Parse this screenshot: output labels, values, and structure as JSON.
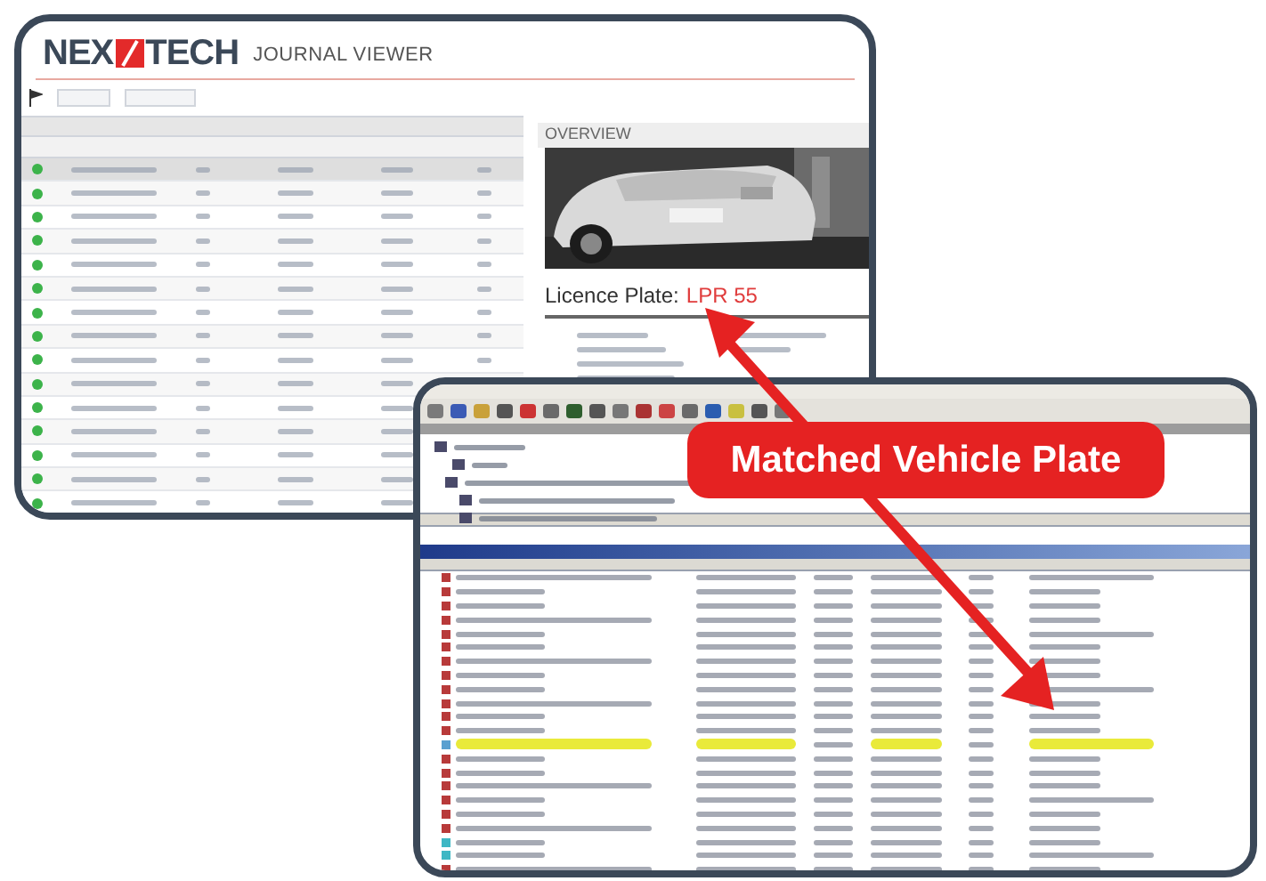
{
  "journal_viewer": {
    "logo": {
      "left": "NEX",
      "right": "TECH"
    },
    "title": "JOURNAL VIEWER",
    "rows": [
      {
        "color": "#3cb34a",
        "selected": true
      },
      {
        "color": "#3cb34a",
        "selected": false
      },
      {
        "color": "#3cb34a",
        "selected": false
      },
      {
        "color": "#3cb34a",
        "selected": false
      },
      {
        "color": "#3cb34a",
        "selected": false
      },
      {
        "color": "#3cb34a",
        "selected": false
      },
      {
        "color": "#3cb34a",
        "selected": false
      },
      {
        "color": "#3cb34a",
        "selected": false
      },
      {
        "color": "#3cb34a",
        "selected": false
      },
      {
        "color": "#3cb34a",
        "selected": false
      },
      {
        "color": "#3cb34a",
        "selected": false
      },
      {
        "color": "#3cb34a",
        "selected": false
      },
      {
        "color": "#3cb34a",
        "selected": false
      },
      {
        "color": "#3cb34a",
        "selected": false
      },
      {
        "color": "#3cb34a",
        "selected": false
      }
    ],
    "overview": {
      "heading": "OVERVIEW",
      "plate_label": "Licence Plate:",
      "plate_value": "LPR 55"
    }
  },
  "alarm_window": {
    "rows": [
      {
        "color": "#b83a3a",
        "highlighted": false
      },
      {
        "color": "#b83a3a",
        "highlighted": false
      },
      {
        "color": "#b83a3a",
        "highlighted": false
      },
      {
        "color": "#b83a3a",
        "highlighted": false
      },
      {
        "color": "#b83a3a",
        "highlighted": false
      },
      {
        "color": "#b83a3a",
        "highlighted": false
      },
      {
        "color": "#b83a3a",
        "highlighted": false
      },
      {
        "color": "#b83a3a",
        "highlighted": false
      },
      {
        "color": "#b83a3a",
        "highlighted": false
      },
      {
        "color": "#b83a3a",
        "highlighted": false
      },
      {
        "color": "#b83a3a",
        "highlighted": false
      },
      {
        "color": "#b83a3a",
        "highlighted": false
      },
      {
        "color": "#5aa0d0",
        "highlighted": true
      },
      {
        "color": "#b83a3a",
        "highlighted": false
      },
      {
        "color": "#b83a3a",
        "highlighted": false
      },
      {
        "color": "#b83a3a",
        "highlighted": false
      },
      {
        "color": "#b83a3a",
        "highlighted": false
      },
      {
        "color": "#b83a3a",
        "highlighted": false
      },
      {
        "color": "#b83a3a",
        "highlighted": false
      },
      {
        "color": "#3fb7c4",
        "highlighted": false
      },
      {
        "color": "#3fb7c4",
        "highlighted": false
      },
      {
        "color": "#b83a3a",
        "highlighted": false
      }
    ]
  },
  "callout": {
    "text": "Matched Vehicle Plate"
  }
}
